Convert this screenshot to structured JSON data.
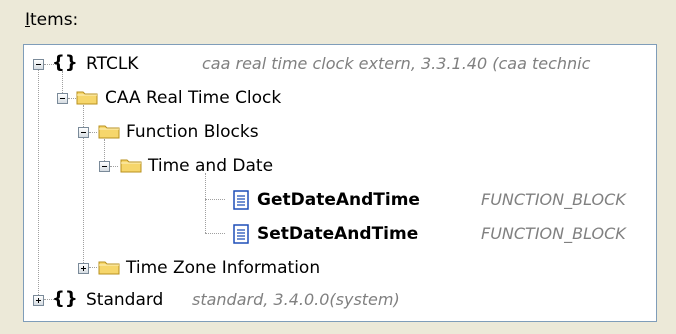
{
  "items_label_underlined": "I",
  "items_label_rest": "tems:",
  "tree": {
    "rtclk": {
      "name": "RTCLK",
      "desc": "caa real time clock extern, 3.3.1.40 (caa technic"
    },
    "caa_rtc": {
      "name": "CAA Real Time Clock"
    },
    "function_blocks": {
      "name": "Function Blocks"
    },
    "time_and_date": {
      "name": "Time and Date"
    },
    "get_date": {
      "name": "GetDateAndTime",
      "desc": "FUNCTION_BLOCK"
    },
    "set_date": {
      "name": "SetDateAndTime",
      "desc": "FUNCTION_BLOCK"
    },
    "time_zone": {
      "name": "Time Zone Information"
    },
    "standard": {
      "name": "Standard",
      "desc": "standard, 3.4.0.0(system)"
    }
  },
  "icons": {
    "library": "braces-icon",
    "folder": "folder-icon",
    "function_block": "document-icon"
  },
  "colors": {
    "background": "#ece9d8",
    "tree_border": "#7f9db9",
    "folder_fill": "#f6d66b",
    "doc_accent": "#1f4fb8"
  }
}
